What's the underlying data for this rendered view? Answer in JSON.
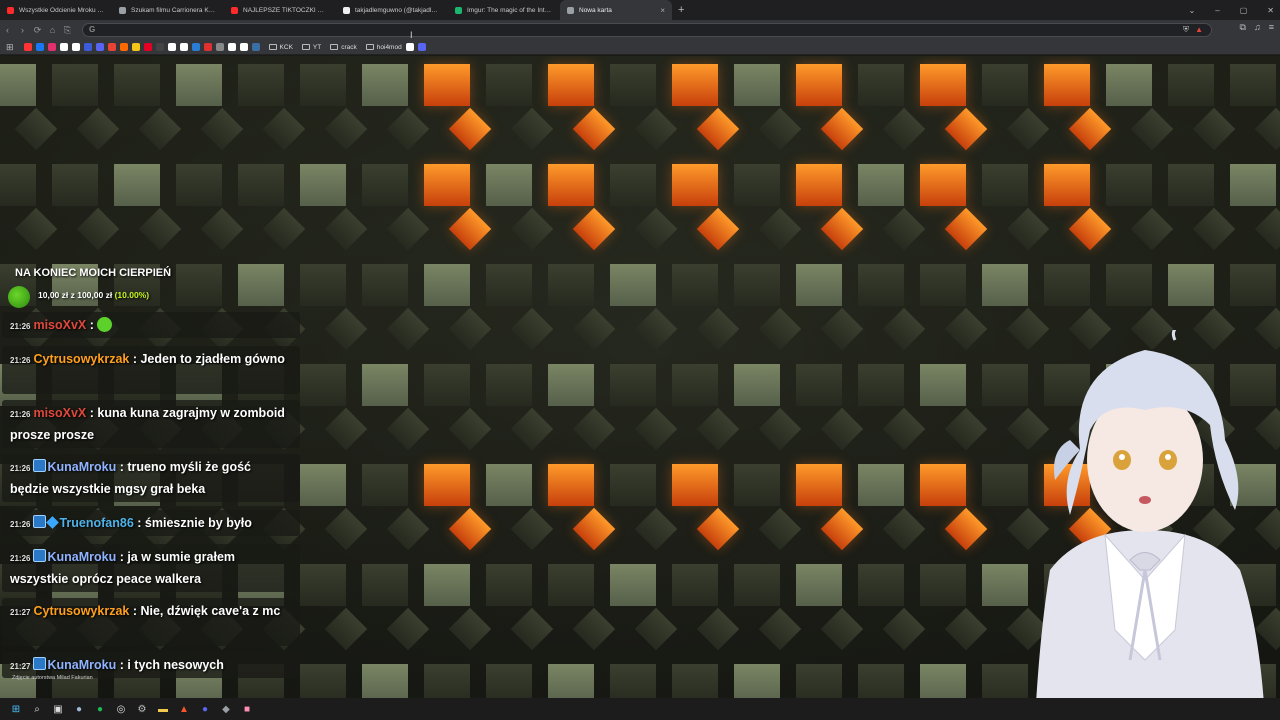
{
  "browser": {
    "tabs": [
      {
        "title": "Wszystkie Odcienie Mroku - YouTube",
        "favicon_color": "#ff2a2a",
        "active": false
      },
      {
        "title": "Szukam filmu Carrionera Katharsis - 1",
        "favicon_color": "#9aa0a6",
        "active": false
      },
      {
        "title": "NAJLEPSZE TIKTOCZKI OD WIDZÓW",
        "favicon_color": "#ff2a2a",
        "active": false
      },
      {
        "title": "takjadlemguwno (@takjadlemguwno)",
        "favicon_color": "#eeeeee",
        "active": false
      },
      {
        "title": "Imgur: The magic of the Internet",
        "favicon_color": "#1bb76e",
        "active": false
      },
      {
        "title": "Nowa karta",
        "favicon_color": "#9aa0a6",
        "active": true
      }
    ],
    "new_tab_symbol": "+",
    "close_symbol": "×",
    "window_controls": [
      "⌄",
      "–",
      "▢",
      "✕"
    ],
    "nav_icons": [
      "‹",
      "›",
      "⟳",
      "⌂",
      "⎘"
    ],
    "omnibox_icon": "G",
    "bookmark_icons": [
      "#ff3333",
      "#1877f2",
      "#e1306c",
      "#ffffff",
      "#ffffff",
      "#3b5bdb",
      "#5865f2",
      "#ea4335",
      "#ff6a00",
      "#f5c518",
      "#e60023",
      "#444444",
      "#ffffff",
      "#ffffff",
      "#2b7cd3",
      "#e03131",
      "#888888",
      "#ffffff",
      "#ffffff",
      "#3a6ea5",
      "#ffffff",
      "#5865f2"
    ],
    "bookmark_folders": [
      "KCK",
      "YT",
      "crack",
      "hoi4mod"
    ]
  },
  "overlay": {
    "donation": {
      "title": "NA KONIEC MOICH CIERPIEŃ",
      "amount": "10,00 zł z 100,00 zł",
      "percent": "(10.00%)",
      "progress_fraction": 0.1
    },
    "chat": [
      {
        "time": "21:26",
        "user": "misoXvX",
        "color": "red",
        "badges": 0,
        "text": ":",
        "emote": true
      },
      {
        "time": "21:26",
        "user": "Cytrusowykrzak",
        "color": "orange",
        "badges": 0,
        "text": ": Jeden to zjadłem gówno"
      },
      {
        "time": "21:26",
        "user": "misoXvX",
        "color": "red",
        "badges": 0,
        "text": ": kuna kuna zagrajmy w zomboid prosze prosze"
      },
      {
        "time": "21:26",
        "user": "KunaMroku",
        "color": "blue",
        "badges": 1,
        "text": ": trueno myśli że gość będzie wszystkie mgsy grał beka"
      },
      {
        "time": "21:26",
        "user": "Truenofan86",
        "color": "cyan",
        "badges": 2,
        "text": ": śmiesznie by było"
      },
      {
        "time": "21:26",
        "user": "KunaMroku",
        "color": "blue",
        "badges": 1,
        "text": ": ja w sumie grałem wszystkie oprócz peace walkera"
      },
      {
        "time": "21:27",
        "user": "Cytrusowykrzak",
        "color": "orange",
        "badges": 0,
        "text": ": Nie, dźwięk cave'a z mc"
      },
      {
        "time": "21:27",
        "user": "KunaMroku",
        "color": "blue",
        "badges": 1,
        "text": ": i tych nesowych"
      }
    ],
    "credit": "Zdjęcie autorstwa Milad Fakurian",
    "settings_icon": "⚙"
  },
  "colors": {
    "username_red": "#e0483b",
    "username_orange": "#ff9f1c",
    "username_blue": "#8fb3ff",
    "username_cyan": "#4fb2e8",
    "progress_green": "#c6f51c",
    "glow_orange": "#ff9a2a",
    "olive": "#7a8564"
  },
  "taskbar": {
    "icons": [
      "windows-icon",
      "search-icon",
      "taskview-icon",
      "steam-icon",
      "spotify-icon",
      "obs-icon",
      "settings-icon",
      "explorer-icon",
      "brave-icon",
      "discord-icon",
      "app-icon",
      "pink-app-icon"
    ]
  }
}
